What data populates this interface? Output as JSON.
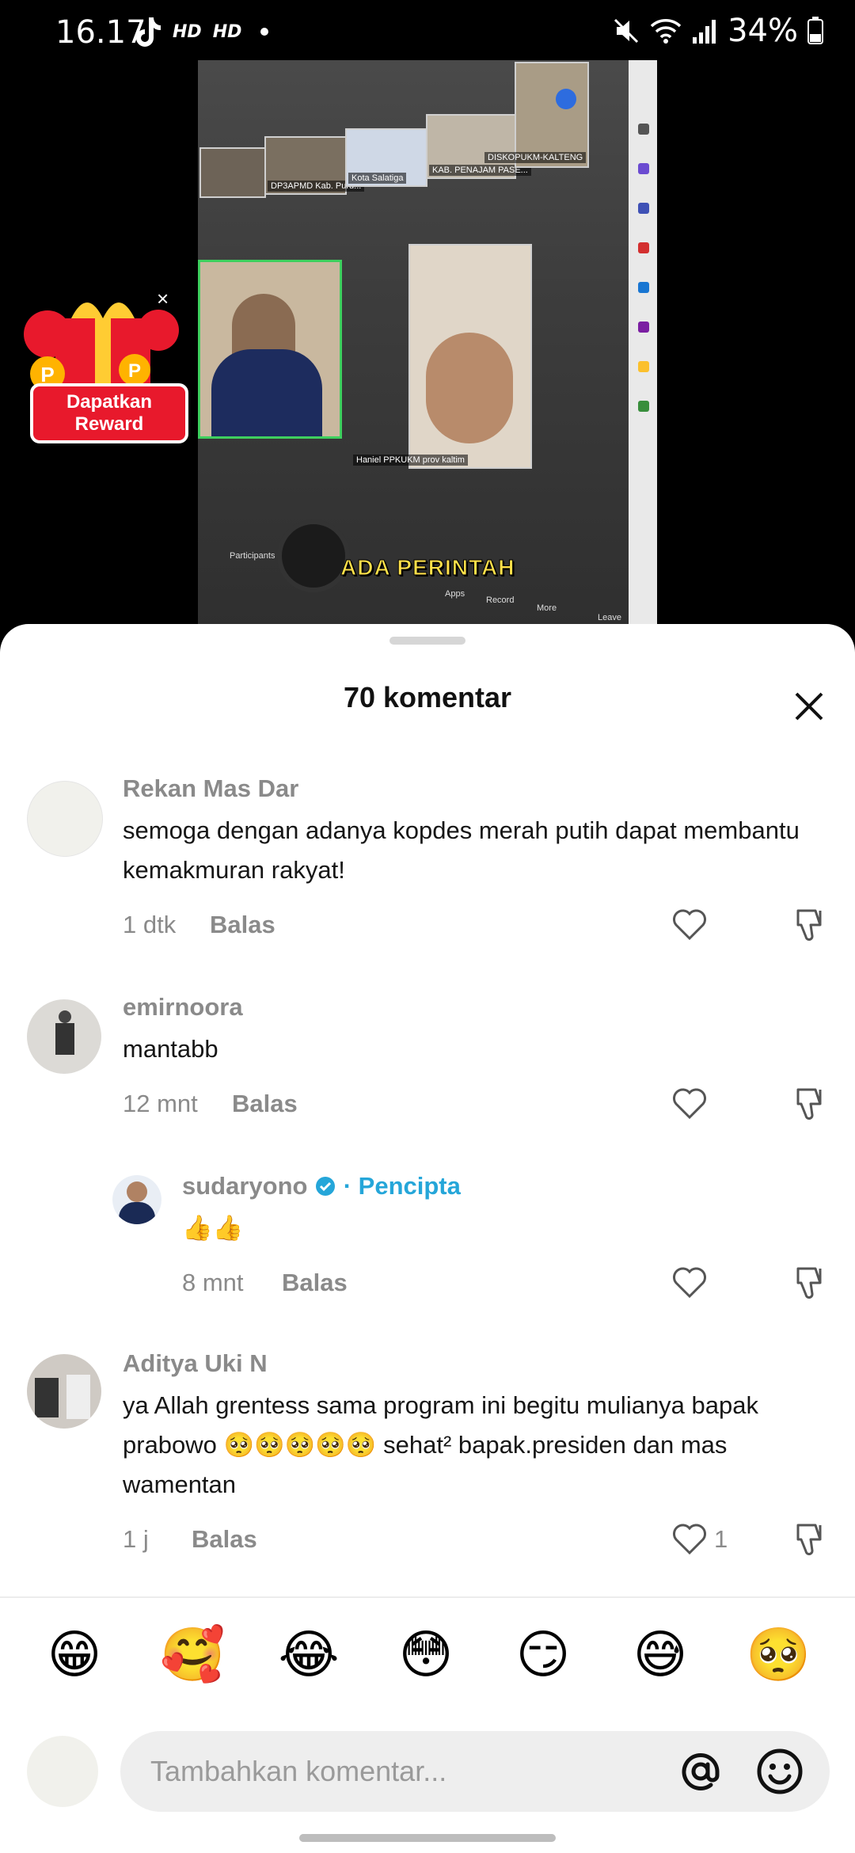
{
  "status_bar": {
    "time": "16.17",
    "hd1": "HD",
    "hd2": "HD",
    "battery": "34%"
  },
  "video": {
    "subtitle": "ADA PERINTAH",
    "tiles": [
      "DP3APMD Kab. Puru...",
      "Kota Salatiga",
      "KAB. PENAJAM PASE...",
      "DISKOPUKM-KALTENG",
      "Haniel PPKUKM prov kaltim"
    ],
    "controls": [
      "Participants",
      "Apps",
      "Record",
      "More",
      "Leave"
    ]
  },
  "reward": {
    "line1": "Dapatkan",
    "line2": "Reward"
  },
  "sheet": {
    "title": "70 komentar"
  },
  "comments": [
    {
      "user": "Rekan Mas Dar",
      "text_line1": "semoga dengan adanya kopdes merah putih dapat membantu",
      "text_line2": "kemakmuran rakyat!",
      "time": "1 dtk",
      "reply": "Balas"
    },
    {
      "user": "emirnoora",
      "text_line1": "mantabb",
      "time": "12 mnt",
      "reply": "Balas"
    },
    {
      "user": "sudaryono",
      "creator_label": "· Pencipta",
      "text_line1": "👍👍",
      "time": "8 mnt",
      "reply": "Balas"
    },
    {
      "user": "Aditya Uki N",
      "text_line1": "ya Allah grentess sama program ini begitu mulianya bapak",
      "text_line2": "prabowo 🥺🥺🥺🥺🥺 sehat² bapak.presiden dan mas",
      "text_line3": "wamentan",
      "time": "1 j",
      "reply": "Balas",
      "likes": "1"
    }
  ],
  "emoji_bar": [
    "😁",
    "🥰",
    "😂",
    "😳",
    "😏",
    "😅",
    "🥺"
  ],
  "input": {
    "placeholder": "Tambahkan komentar..."
  },
  "colors": {
    "accent": "#25a6d9",
    "reward_red": "#e8192c",
    "subtitle_yellow": "#ffe14a"
  }
}
